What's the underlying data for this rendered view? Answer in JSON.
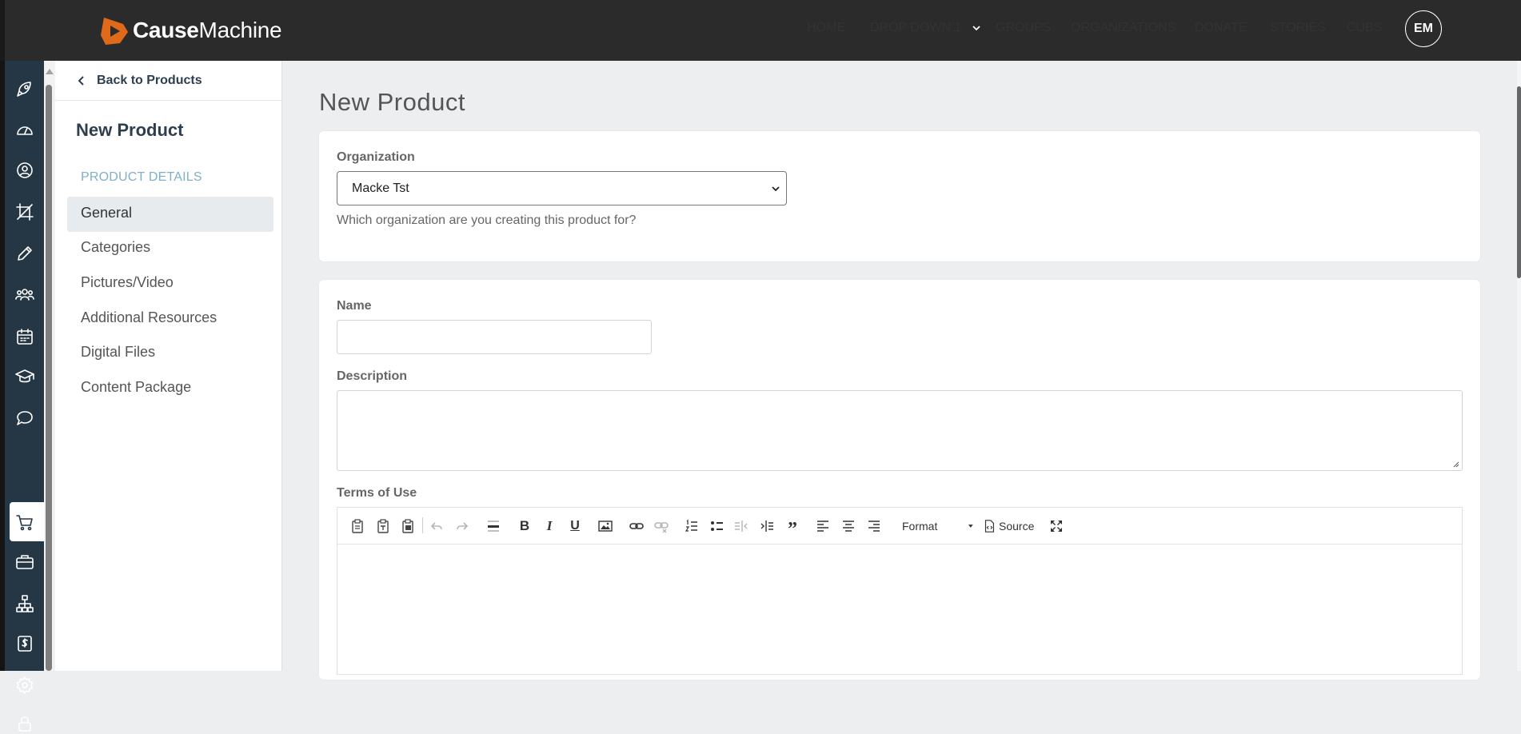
{
  "brand": {
    "name_bold": "Cause",
    "name_regular": "Machine",
    "accent": "#e06a1b"
  },
  "topnav": {
    "items": [
      "HOME",
      "DROP DOWN 1",
      "GROUPS",
      "ORGANIZATIONS",
      "DONATE",
      "STORIES",
      "CUBS"
    ],
    "avatar_initials": "EM"
  },
  "rail": {
    "icons": [
      "rocket-icon",
      "dashboard-icon",
      "user-circle-icon",
      "crop-icon",
      "pencil-icon",
      "users-icon",
      "calendar-icon",
      "graduation-cap-icon",
      "chat-icon",
      "cart-icon",
      "briefcase-icon",
      "sitemap-icon",
      "dollar-icon",
      "gear-icon",
      "lock-icon"
    ],
    "active": "cart-icon"
  },
  "subnav": {
    "back_label": "Back to Products",
    "title": "New Product",
    "section_label": "PRODUCT DETAILS",
    "items": [
      "General",
      "Categories",
      "Pictures/Video",
      "Additional Resources",
      "Digital Files",
      "Content Package"
    ],
    "active": "General"
  },
  "main": {
    "title": "New Product",
    "organization": {
      "label": "Organization",
      "selected": "Macke Tst",
      "help": "Which organization are you creating this product for?"
    },
    "name": {
      "label": "Name",
      "value": ""
    },
    "description": {
      "label": "Description",
      "value": ""
    },
    "terms": {
      "label": "Terms of Use",
      "toolbar": {
        "format_label": "Format",
        "source_label": "Source"
      }
    }
  }
}
